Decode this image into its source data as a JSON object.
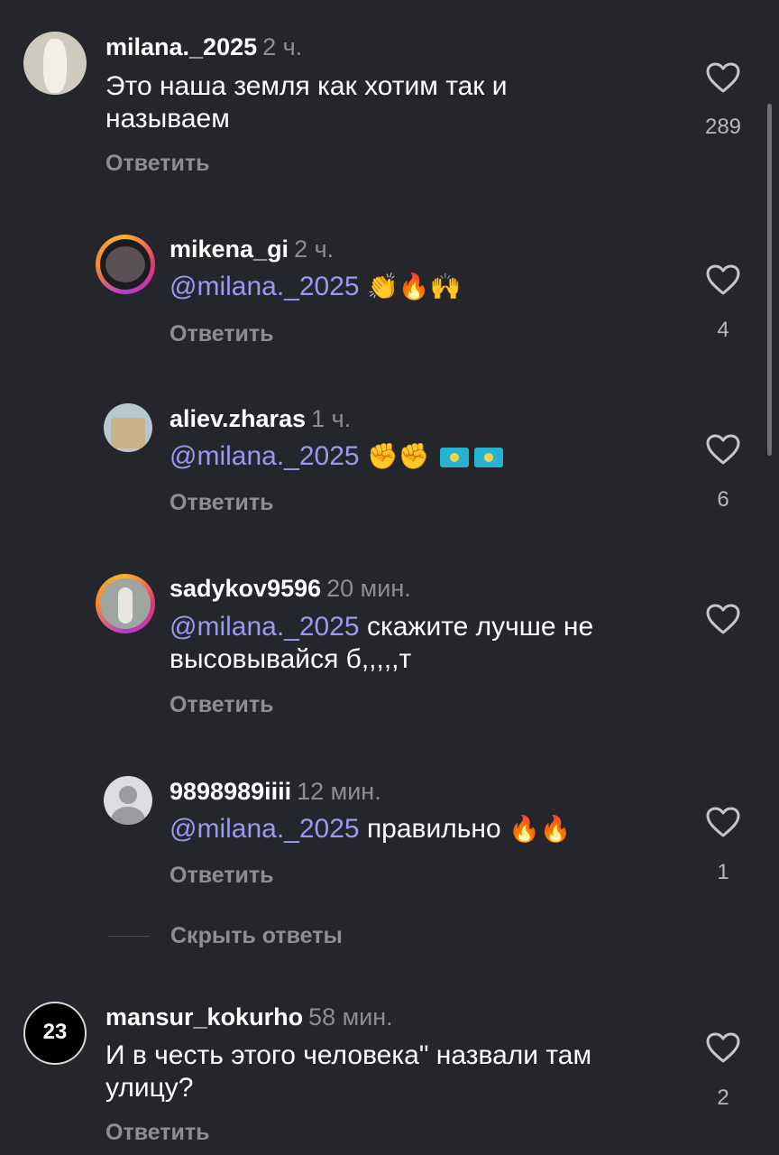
{
  "reply_label": "Ответить",
  "hide_replies_label": "Скрыть ответы",
  "comments": [
    {
      "username": "milana._2025",
      "time": "2 ч.",
      "text": "Это наша земля как хотим так и называем",
      "likes": "289"
    },
    {
      "username": "mikena_gi",
      "time": "2 ч.",
      "mention": "@milana._2025",
      "text": "",
      "emoji": "👏🔥🙌",
      "likes": "4"
    },
    {
      "username": "aliev.zharas",
      "time": "1 ч.",
      "mention": "@milana._2025",
      "text": "",
      "emoji": "✊✊",
      "likes": "6"
    },
    {
      "username": "sadykov9596",
      "time": "20 мин.",
      "mention": "@milana._2025",
      "text": "скажите лучше не высовывайся б,,,,,т",
      "likes": ""
    },
    {
      "username": "9898989iiii",
      "time": "12 мин.",
      "mention": "@milana._2025",
      "text": "правильно",
      "emoji": "🔥🔥",
      "likes": "1"
    },
    {
      "username": "mansur_kokurho",
      "time": "58 мин.",
      "text": "И в честь этого человека\" назвали там улицу?",
      "likes": "2",
      "avatar_text": "23"
    }
  ]
}
